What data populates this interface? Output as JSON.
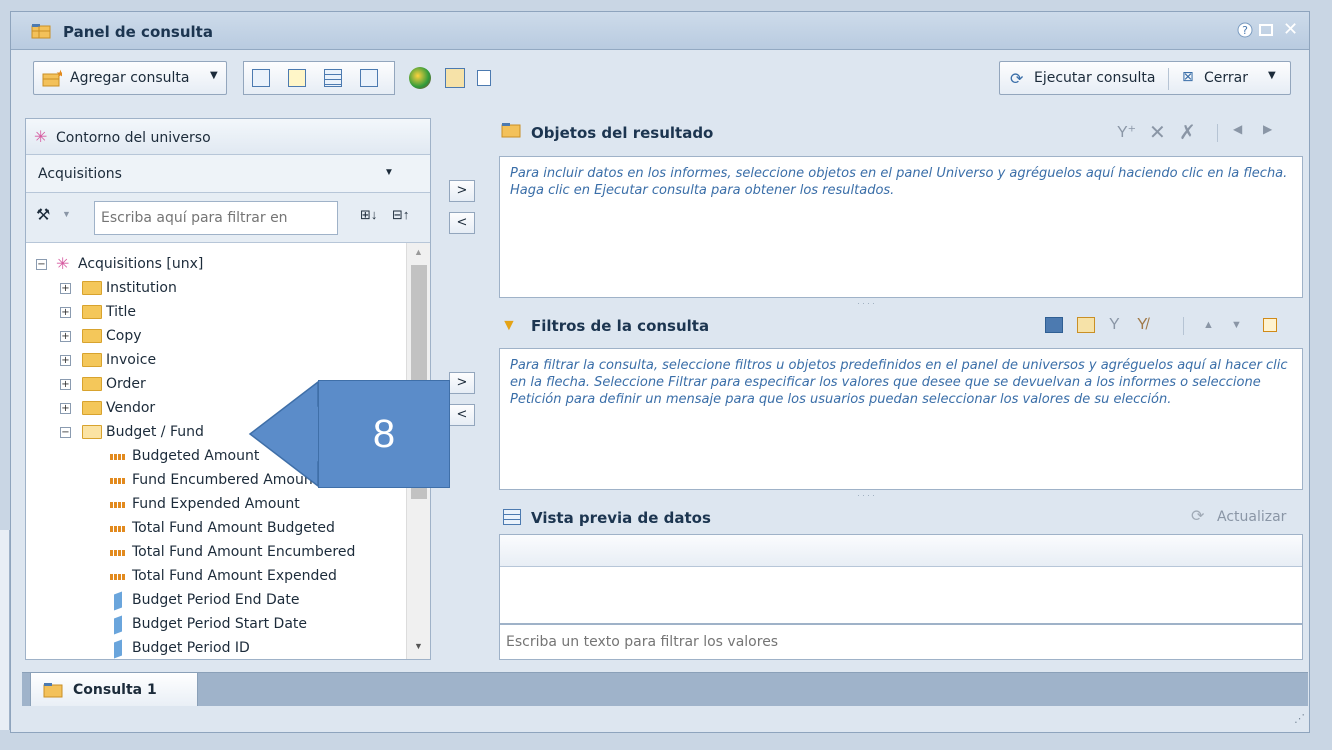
{
  "window": {
    "title": "Panel de consulta"
  },
  "toolbar": {
    "add_query": "Agregar consulta",
    "run_query": "Ejecutar consulta",
    "close": "Cerrar"
  },
  "universe": {
    "title": "Contorno del universo",
    "selected": "Acquisitions",
    "filter_placeholder": "Escriba aquí para filtrar en",
    "root": "Acquisitions [unx]",
    "folders": [
      "Institution",
      "Title",
      "Copy",
      "Invoice",
      "Order",
      "Vendor"
    ],
    "open_folder": "Budget / Fund",
    "measures": [
      "Budgeted Amount",
      "Fund Encumbered Amount",
      "Fund Expended Amount",
      "Total Fund Amount Budgeted",
      "Total Fund Amount Encumbered",
      "Total Fund Amount Expended"
    ],
    "dimensions": [
      "Budget Period End Date",
      "Budget Period Start Date",
      "Budget Period ID"
    ]
  },
  "result_objects": {
    "title": "Objetos del resultado",
    "hint": "Para incluir datos en los informes, seleccione objetos en el panel Universo y agréguelos aquí haciendo clic en la flecha. Haga clic en Ejecutar consulta para obtener los resultados."
  },
  "query_filters": {
    "title": "Filtros de la consulta",
    "hint": "Para filtrar la consulta, seleccione filtros u objetos predefinidos en el panel de universos y agréguelos aquí al hacer clic en la flecha. Seleccione Filtrar para especificar los valores que desee que se devuelvan a los informes o seleccione Petición para definir un mensaje para que los usuarios puedan seleccionar los valores de su elección."
  },
  "data_preview": {
    "title": "Vista previa de datos",
    "refresh": "Actualizar",
    "filter_placeholder": "Escriba un texto para filtrar los valores"
  },
  "arrows": {
    "add": ">",
    "remove": "<"
  },
  "tabs": [
    "Consulta 1"
  ],
  "callout": {
    "number": "8"
  },
  "colors": {
    "accent": "#3a6ea8",
    "callout": "#5b8cc9",
    "folder": "#f4c75a"
  }
}
